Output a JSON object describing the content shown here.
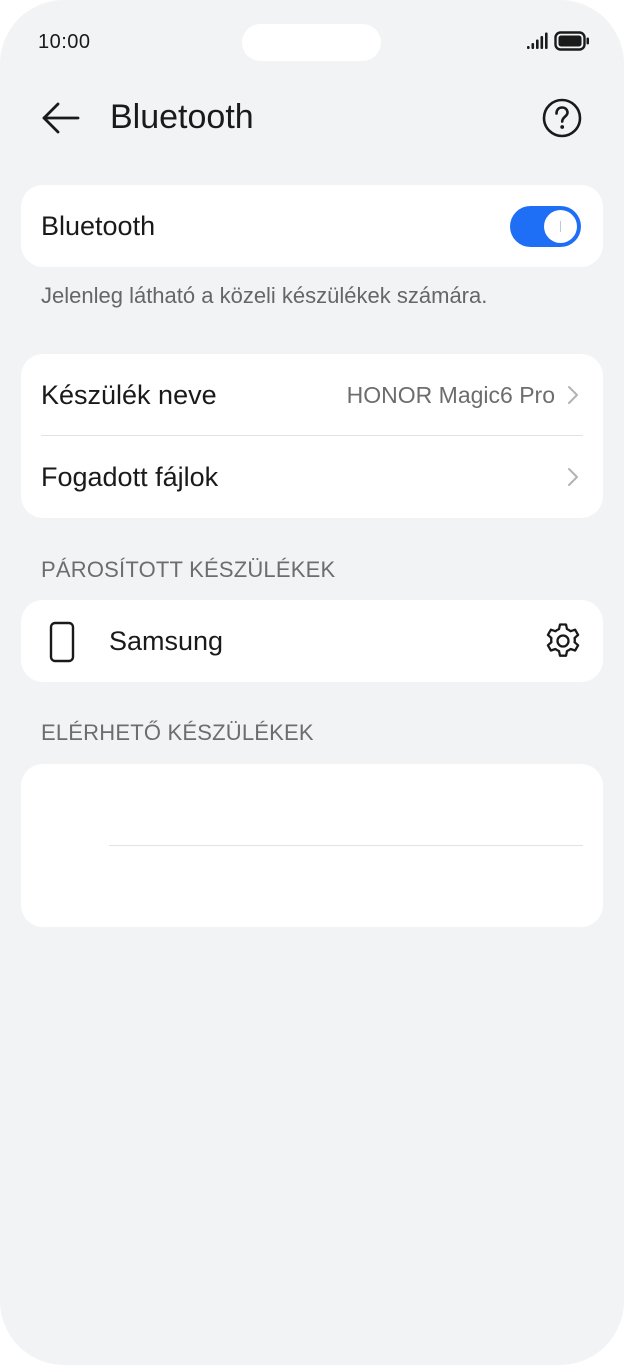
{
  "status_bar": {
    "time": "10:00",
    "signal_icon": "signal-bars-icon",
    "battery_icon": "battery-full-icon"
  },
  "header": {
    "back_icon": "arrow-left-icon",
    "title": "Bluetooth",
    "help_icon": "question-circle-icon"
  },
  "bluetooth": {
    "label": "Bluetooth",
    "enabled": true,
    "toggle_color": "#1f6ff6",
    "visibility_hint": "Jelenleg látható a közeli készülékek számára."
  },
  "settings": {
    "device_name_label": "Készülék neve",
    "device_name_value": "HONOR Magic6 Pro",
    "received_files_label": "Fogadott fájlok"
  },
  "paired": {
    "section_title": "PÁROSÍTOTT KÉSZÜLÉKEK",
    "devices": [
      {
        "name": "Samsung",
        "icon": "phone-device-icon",
        "settings_icon": "gear-icon"
      }
    ]
  },
  "available": {
    "section_title": "ELÉRHETŐ KÉSZÜLÉKEK"
  }
}
